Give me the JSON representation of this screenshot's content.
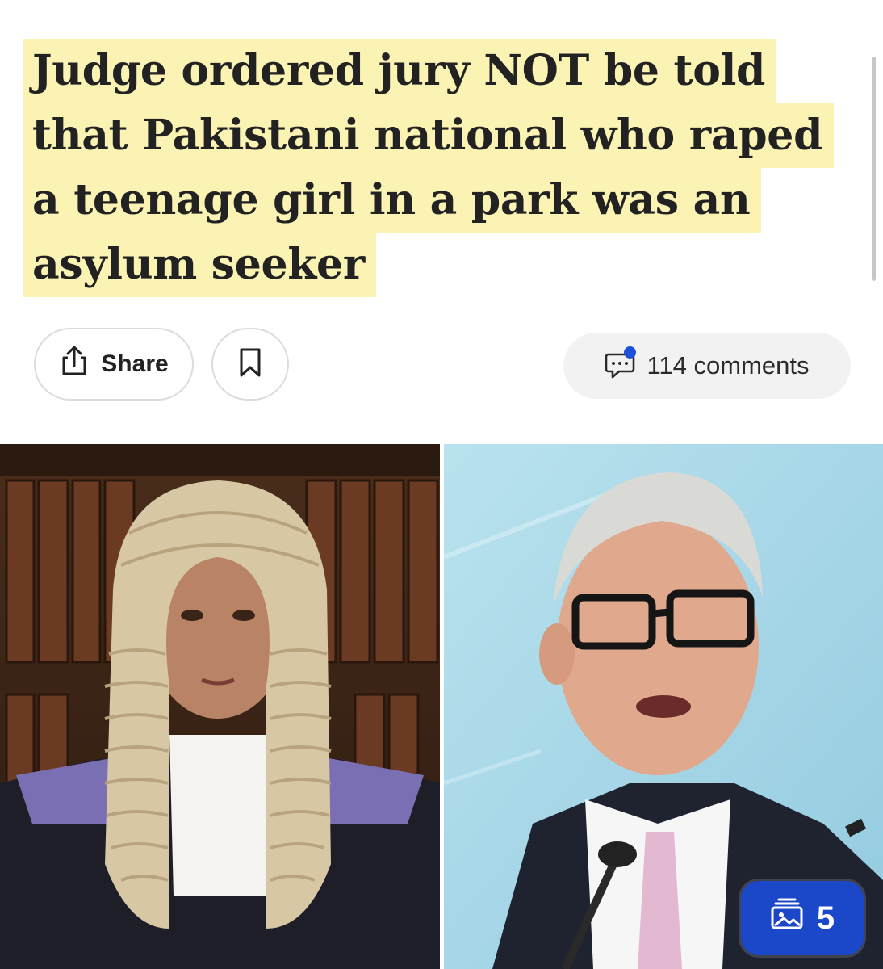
{
  "article": {
    "headline_lines": [
      "Judge ordered jury NOT be told",
      "that Pakistani national who raped",
      "a teenage girl in a park was an",
      "asylum seeker"
    ]
  },
  "actions": {
    "share_label": "Share",
    "share_icon": "share-icon",
    "bookmark_icon": "bookmark-icon",
    "comments_label": "114 comments",
    "comments_icon": "comment-bubble-icon"
  },
  "gallery": {
    "count": "5",
    "icon": "image-gallery-icon"
  },
  "colors": {
    "highlight": "#fbf3b4",
    "notification_dot": "#1d4fd7",
    "gallery_badge": "#1b47c9"
  }
}
